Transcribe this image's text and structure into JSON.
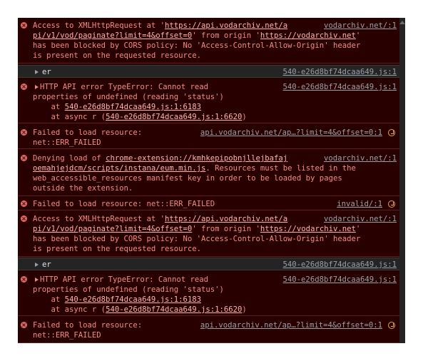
{
  "messages": [
    {
      "type": "error",
      "source": "vodarchiv.net/:1",
      "lines": [
        [
          "Access to XMLHttpRequest at '",
          {
            "link": "https://api.vodarchiv.net/a"
          }
        ],
        [
          {
            "link": "pi/v1/vod/paginate?limit=4&offset=0"
          },
          "' from origin '",
          {
            "link": "https://vodarchiv.net"
          },
          "'"
        ],
        [
          "has been blocked by CORS policy: No 'Access-Control-Allow-Origin' header"
        ],
        [
          "is present on the requested resource."
        ]
      ]
    },
    {
      "type": "info",
      "text": "er",
      "source": "540-e26d8bf74dcaa649.js:1"
    },
    {
      "type": "error",
      "source": "540-e26d8bf74dcaa649.js:1",
      "lines": [
        [
          "HTTP API error TypeError: Cannot read"
        ],
        [
          "properties of undefined (reading 'status')"
        ],
        [
          "    at ",
          {
            "link": "540-e26d8bf74dcaa649.js:1:6183"
          }
        ],
        [
          "    at async r (",
          {
            "link": "540-e26d8bf74dcaa649.js:1:6620"
          },
          ")"
        ]
      ]
    },
    {
      "type": "error",
      "source": "api.vodarchiv.net/ap…?limit=4&offset=0:1",
      "lines": [
        [
          "Failed to load resource:"
        ],
        [
          "net::ERR_FAILED"
        ]
      ]
    },
    {
      "type": "error",
      "source": "vodarchiv.net/:1",
      "lines": [
        [
          "Denying load of ",
          {
            "link": "chrome-extension://kmhkepipobnjllejbafaj"
          }
        ],
        [
          {
            "link": "oemahjejdcm/scripts/instana/eum.min.js"
          },
          ". Resources must be listed in the"
        ],
        [
          "web_accessible_resources manifest key in order to be loaded by pages"
        ],
        [
          "outside the extension."
        ]
      ]
    },
    {
      "type": "error",
      "source": "invalid/:1",
      "lines": [
        [
          "Failed to load resource: net::ERR_FAILED"
        ]
      ]
    },
    {
      "type": "error",
      "source": "vodarchiv.net/:1",
      "lines": [
        [
          "Access to XMLHttpRequest at '",
          {
            "link": "https://api.vodarchiv.net/a"
          }
        ],
        [
          {
            "link": "pi/v1/vod/paginate?limit=4&offset=0"
          },
          "' from origin '",
          {
            "link": "https://vodarchiv.net"
          },
          "'"
        ],
        [
          "has been blocked by CORS policy: No 'Access-Control-Allow-Origin' header"
        ],
        [
          "is present on the requested resource."
        ]
      ]
    },
    {
      "type": "info",
      "text": "er",
      "source": "540-e26d8bf74dcaa649.js:1"
    },
    {
      "type": "error",
      "source": "540-e26d8bf74dcaa649.js:1",
      "lines": [
        [
          "HTTP API error TypeError: Cannot read"
        ],
        [
          "properties of undefined (reading 'status')"
        ],
        [
          "    at ",
          {
            "link": "540-e26d8bf74dcaa649.js:1:6183"
          }
        ],
        [
          "    at async r (",
          {
            "link": "540-e26d8bf74dcaa649.js:1:6620"
          },
          ")"
        ]
      ]
    },
    {
      "type": "error",
      "source": "api.vodarchiv.net/ap…?limit=4&offset=0:1",
      "lines": [
        [
          "Failed to load resource:"
        ],
        [
          "net::ERR_FAILED"
        ]
      ]
    }
  ],
  "icons": {
    "error": "error-circle-icon",
    "expand": "expand-triangle-icon",
    "network": "network-request-icon",
    "scroll": "scroll-up-arrow-icon"
  },
  "colors": {
    "error_background": "#290000",
    "error_text": "#f28b82",
    "info_background": "#242424",
    "info_text": "#e3e3e3",
    "source_link": "#9aa0a6",
    "network_icon": "#e8a33d"
  }
}
